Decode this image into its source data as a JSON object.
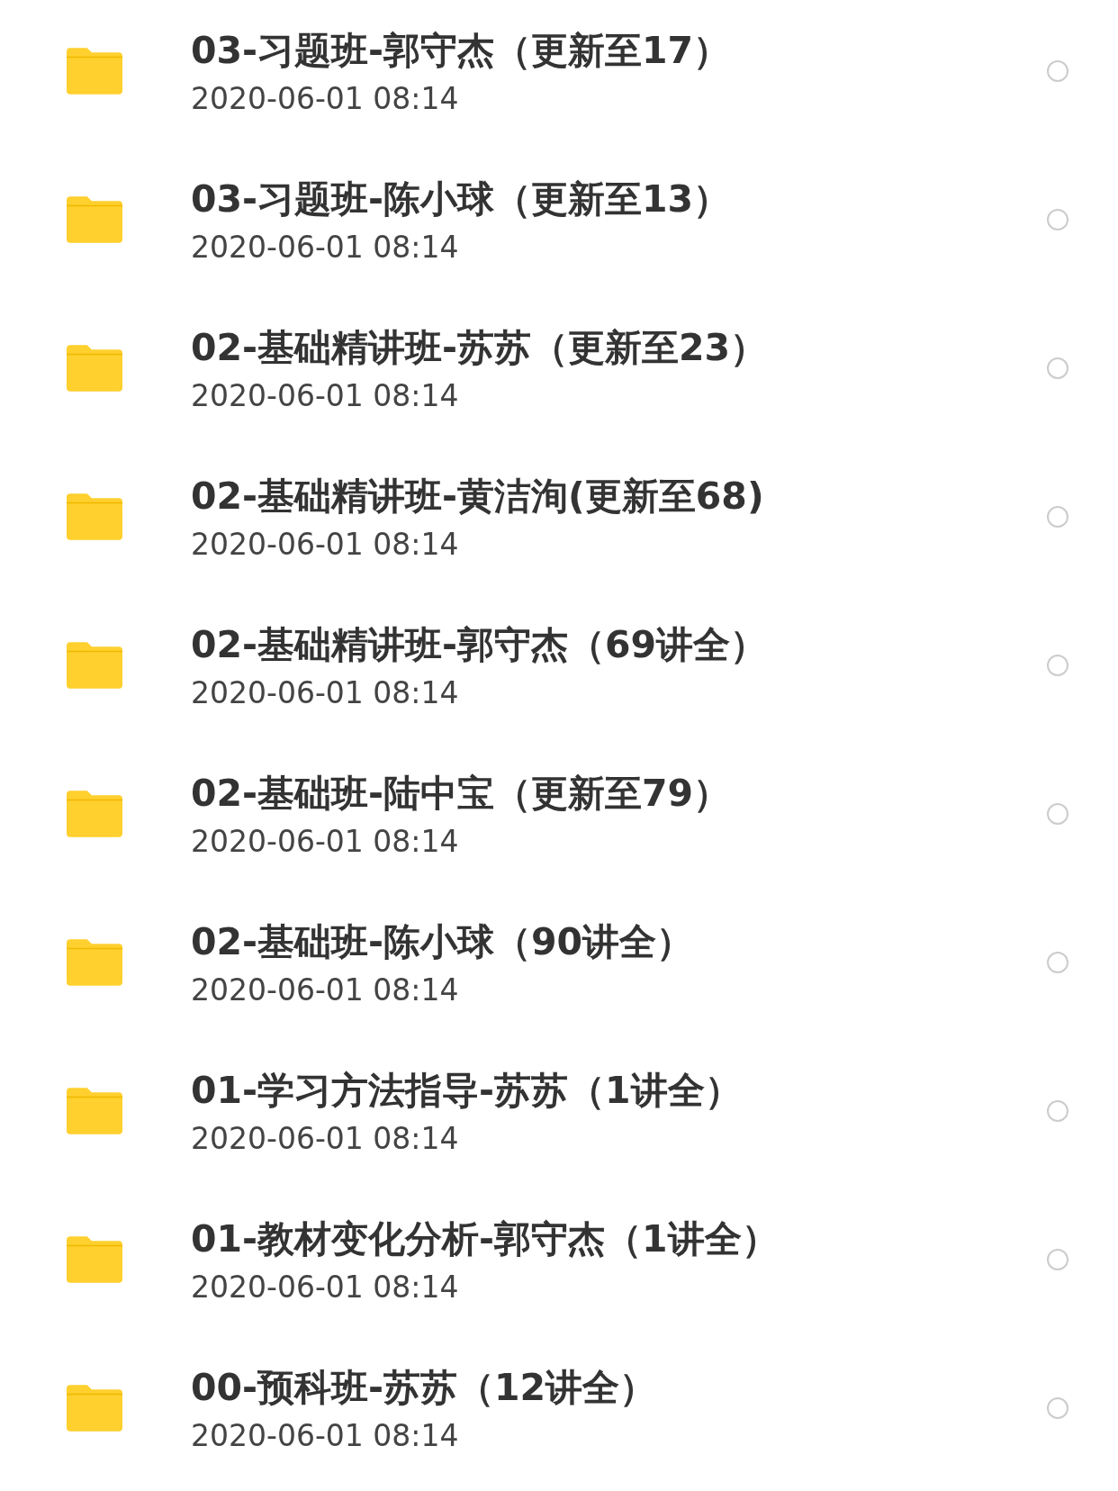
{
  "files": [
    {
      "name": "03-习题班-郭守杰（更新至17）",
      "date": "2020-06-01 08:14",
      "selected": false
    },
    {
      "name": "03-习题班-陈小球（更新至13）",
      "date": "2020-06-01 08:14",
      "selected": false
    },
    {
      "name": "02-基础精讲班-苏苏（更新至23）",
      "date": "2020-06-01 08:14",
      "selected": false
    },
    {
      "name": "02-基础精讲班-黄洁洵(更新至68)",
      "date": "2020-06-01 08:14",
      "selected": false
    },
    {
      "name": "02-基础精讲班-郭守杰（69讲全）",
      "date": "2020-06-01 08:14",
      "selected": false
    },
    {
      "name": "02-基础班-陆中宝（更新至79）",
      "date": "2020-06-01 08:14",
      "selected": false
    },
    {
      "name": "02-基础班-陈小球（90讲全）",
      "date": "2020-06-01 08:14",
      "selected": false
    },
    {
      "name": "01-学习方法指导-苏苏（1讲全）",
      "date": "2020-06-01 08:14",
      "selected": false
    },
    {
      "name": "01-教材变化分析-郭守杰（1讲全）",
      "date": "2020-06-01 08:14",
      "selected": false
    },
    {
      "name": "00-预科班-苏苏（12讲全）",
      "date": "2020-06-01 08:14",
      "selected": false
    }
  ]
}
